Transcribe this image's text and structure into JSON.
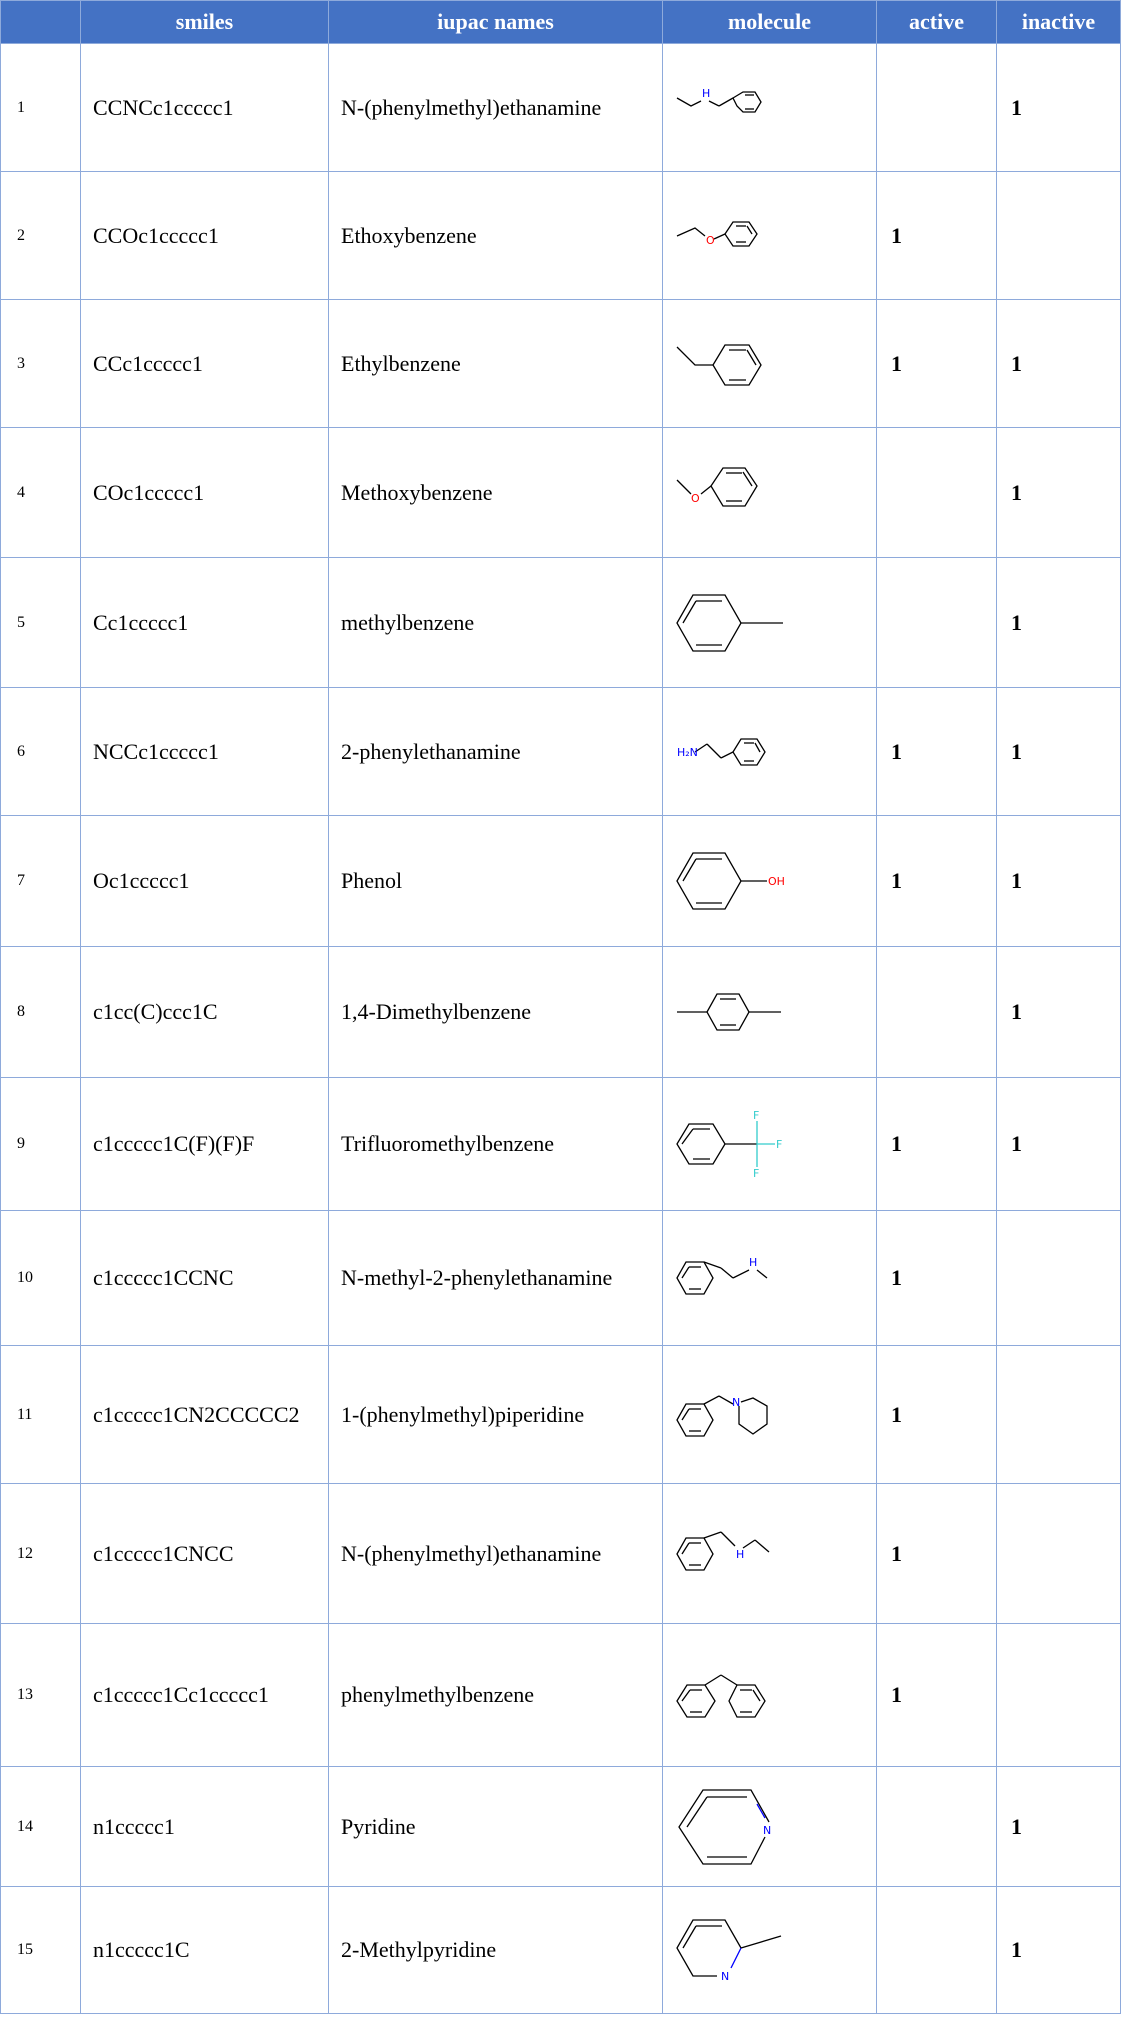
{
  "header": {
    "index": "",
    "smiles": "smiles",
    "iupac": "iupac names",
    "molecule": "molecule",
    "active": "active",
    "inactive": "inactive"
  },
  "rows": [
    {
      "index": "1",
      "smiles": "CCNCc1ccccc1",
      "iupac": "N-(phenylmethyl)ethanamine",
      "molecule_icon": "n-benzylethylamine-structure",
      "active": "",
      "inactive": "1"
    },
    {
      "index": "2",
      "smiles": "CCOc1ccccc1",
      "iupac": "Ethoxybenzene",
      "molecule_icon": "ethoxybenzene-structure",
      "active": "1",
      "inactive": ""
    },
    {
      "index": "3",
      "smiles": "CCc1ccccc1",
      "iupac": "Ethylbenzene",
      "molecule_icon": "ethylbenzene-structure",
      "active": "1",
      "inactive": "1"
    },
    {
      "index": "4",
      "smiles": "COc1ccccc1",
      "iupac": "Methoxybenzene",
      "molecule_icon": "methoxybenzene-structure",
      "active": "",
      "inactive": "1"
    },
    {
      "index": "5",
      "smiles": "Cc1ccccc1",
      "iupac": "methylbenzene",
      "molecule_icon": "methylbenzene-structure",
      "active": "",
      "inactive": "1"
    },
    {
      "index": "6",
      "smiles": "NCCc1ccccc1",
      "iupac": "2-phenylethanamine",
      "molecule_icon": "phenylethylamine-structure",
      "active": "1",
      "inactive": "1"
    },
    {
      "index": "7",
      "smiles": "Oc1ccccc1",
      "iupac": "Phenol",
      "molecule_icon": "phenol-structure",
      "active": "1",
      "inactive": "1"
    },
    {
      "index": "8",
      "smiles": "c1cc(C)ccc1C",
      "iupac": "1,4-Dimethylbenzene",
      "molecule_icon": "p-xylene-structure",
      "active": "",
      "inactive": "1"
    },
    {
      "index": "9",
      "smiles": "c1ccccc1C(F)(F)F",
      "iupac": "Trifluoromethylbenzene",
      "molecule_icon": "trifluoromethylbenzene-structure",
      "active": "1",
      "inactive": "1"
    },
    {
      "index": "10",
      "smiles": "c1ccccc1CCNC",
      "iupac": "N-methyl-2-phenylethanamine",
      "molecule_icon": "n-methylphenethylamine-structure",
      "active": "1",
      "inactive": ""
    },
    {
      "index": "11",
      "smiles": "c1ccccc1CN2CCCCC2",
      "iupac": "1-(phenylmethyl)piperidine",
      "molecule_icon": "benzylpiperidine-structure",
      "active": "1",
      "inactive": ""
    },
    {
      "index": "12",
      "smiles": "c1ccccc1CNCC",
      "iupac": "N-(phenylmethyl)ethanamine",
      "molecule_icon": "n-benzylethylamine-structure",
      "active": "1",
      "inactive": ""
    },
    {
      "index": "13",
      "smiles": "c1ccccc1Cc1ccccc1",
      "iupac": "phenylmethylbenzene",
      "molecule_icon": "diphenylmethane-structure",
      "active": "1",
      "inactive": ""
    },
    {
      "index": "14",
      "smiles": "n1ccccc1",
      "iupac": "Pyridine",
      "molecule_icon": "pyridine-structure",
      "active": "",
      "inactive": "1"
    },
    {
      "index": "15",
      "smiles": "n1ccccc1C",
      "iupac": "2-Methylpyridine",
      "molecule_icon": "2-methylpyridine-structure",
      "active": "",
      "inactive": "1"
    }
  ],
  "atom_labels": {
    "r1_nh": "H",
    "r2_o": "O",
    "r4_o": "O",
    "r6_nh2": "H₂N",
    "r7_oh": "OH",
    "r9_f1": "F",
    "r9_f2": "F",
    "r9_f3": "F",
    "r10_nh": "H",
    "r11_n": "N",
    "r12_nh": "H",
    "r14_n": "N",
    "r15_n": "N"
  },
  "colors": {
    "header_bg": "#4472c4",
    "grid": "#8eaadb",
    "nitrogen": "#0000ff",
    "oxygen": "#ff0000",
    "fluorine": "#33cccc"
  }
}
